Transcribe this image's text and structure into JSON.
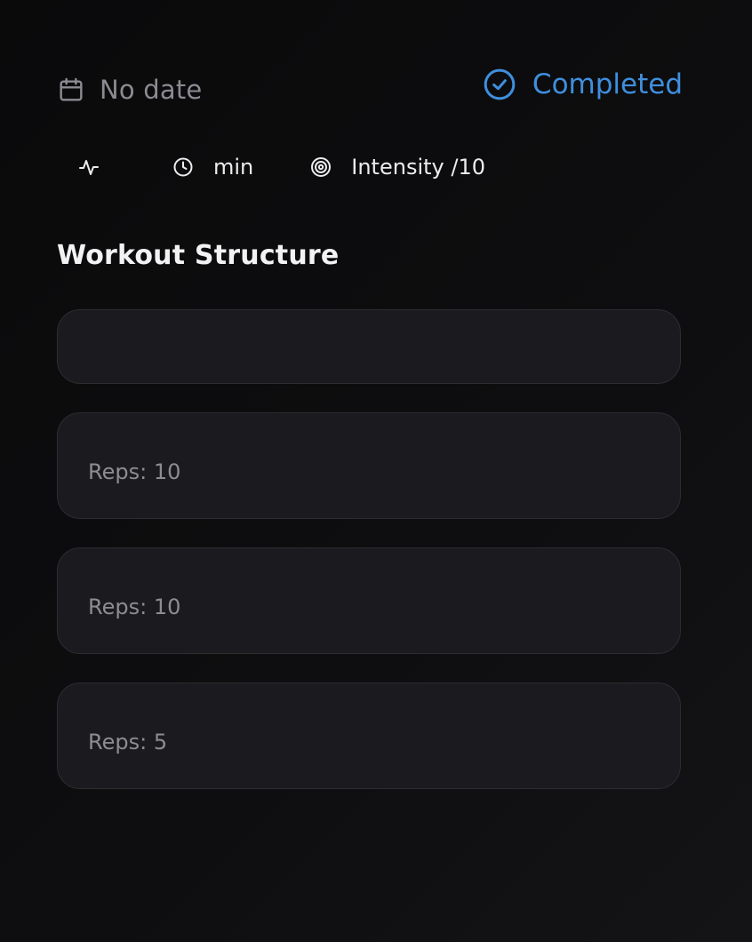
{
  "header": {
    "date_text": "No date",
    "status_text": "Completed",
    "icons": {
      "date": "calendar-icon",
      "status": "check-circle-icon"
    }
  },
  "meta": {
    "items": [
      {
        "icon": "activity-icon",
        "label": ""
      },
      {
        "icon": "clock-icon",
        "label": "min"
      },
      {
        "icon": "target-icon",
        "label": "Intensity /10"
      }
    ]
  },
  "structure": {
    "title": "Workout Structure",
    "cards": [
      {
        "reps_text": ""
      },
      {
        "reps_text": "Reps: 10"
      },
      {
        "reps_text": "Reps: 10"
      },
      {
        "reps_text": "Reps: 5"
      }
    ]
  },
  "colors": {
    "accent": "#3f8fde",
    "card_bg": "#1b1b1f",
    "muted_text": "#8c8c93"
  }
}
